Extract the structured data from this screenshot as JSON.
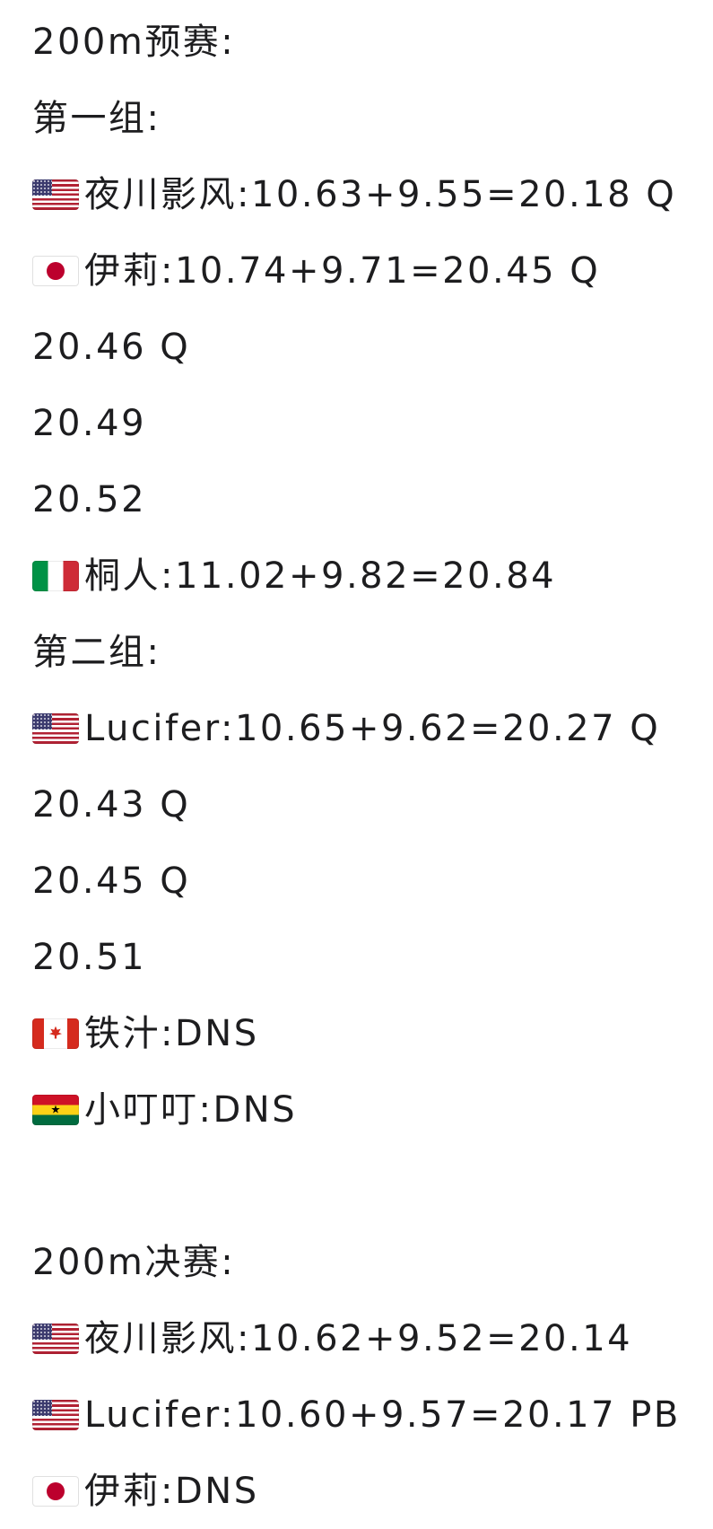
{
  "lines": [
    {
      "flag": "",
      "text": "200m预赛:"
    },
    {
      "flag": "",
      "text": "第一组:"
    },
    {
      "flag": "us",
      "text": "夜川影风:10.63+9.55=20.18 Q"
    },
    {
      "flag": "jp",
      "text": "伊莉:10.74+9.71=20.45 Q"
    },
    {
      "flag": "",
      "text": "20.46 Q"
    },
    {
      "flag": "",
      "text": "20.49"
    },
    {
      "flag": "",
      "text": "20.52"
    },
    {
      "flag": "it",
      "text": "桐人:11.02+9.82=20.84"
    },
    {
      "flag": "",
      "text": "第二组:"
    },
    {
      "flag": "us",
      "text": "Lucifer:10.65+9.62=20.27 Q"
    },
    {
      "flag": "",
      "text": "20.43 Q"
    },
    {
      "flag": "",
      "text": "20.45 Q"
    },
    {
      "flag": "",
      "text": "20.51"
    },
    {
      "flag": "ca",
      "text": "铁汁:DNS"
    },
    {
      "flag": "gh",
      "text": "小叮叮:DNS"
    },
    {
      "flag": "",
      "text": ""
    },
    {
      "flag": "",
      "text": "200m决赛:"
    },
    {
      "flag": "us",
      "text": "夜川影风:10.62+9.52=20.14"
    },
    {
      "flag": "us",
      "text": "Lucifer:10.60+9.57=20.17 PB"
    },
    {
      "flag": "jp",
      "text": "伊莉:DNS"
    }
  ],
  "flags": {
    "us": {
      "icon": "us-flag-icon",
      "colors": [
        "#b22234",
        "#ffffff",
        "#3c3b6e"
      ]
    },
    "jp": {
      "icon": "japan-flag-icon",
      "colors": [
        "#ffffff",
        "#bc002d"
      ]
    },
    "it": {
      "icon": "italy-flag-icon",
      "colors": [
        "#009246",
        "#ffffff",
        "#ce2b37"
      ]
    },
    "ca": {
      "icon": "canada-flag-icon",
      "colors": [
        "#d52b1e",
        "#ffffff"
      ]
    },
    "gh": {
      "icon": "ghana-flag-icon",
      "colors": [
        "#ce1126",
        "#fcd116",
        "#006b3f"
      ]
    }
  }
}
